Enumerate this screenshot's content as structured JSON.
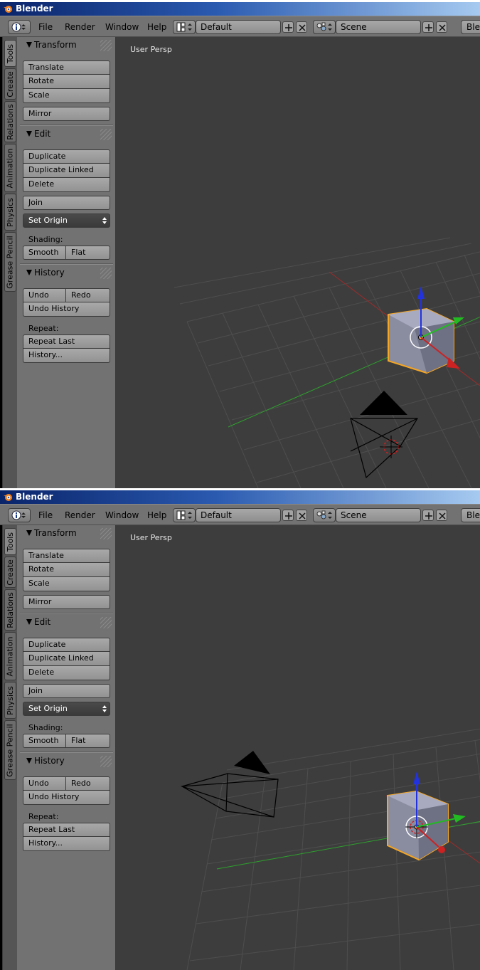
{
  "window_title": "Blender",
  "menu": [
    "File",
    "Render",
    "Window",
    "Help"
  ],
  "screen_layout": "Default",
  "scene_name": "Scene",
  "engine_cut": "Blen",
  "side_tabs": [
    "Tools",
    "Create",
    "Relations",
    "Animation",
    "Physics",
    "Grease Pencil"
  ],
  "transform": {
    "title": "Transform",
    "translate": "Translate",
    "rotate": "Rotate",
    "scale": "Scale",
    "mirror": "Mirror"
  },
  "edit": {
    "title": "Edit",
    "duplicate": "Duplicate",
    "duplicate_linked": "Duplicate Linked",
    "delete": "Delete",
    "join": "Join",
    "set_origin": "Set Origin",
    "shading_label": "Shading:",
    "smooth": "Smooth",
    "flat": "Flat"
  },
  "history": {
    "title": "History",
    "undo": "Undo",
    "redo": "Redo",
    "undo_history": "Undo History",
    "repeat_label": "Repeat:",
    "repeat_last": "Repeat Last",
    "history_more": "History..."
  },
  "viewport_label": "User Persp",
  "colors": {
    "viewport_bg": "#3d3d3d",
    "panel_bg": "#727272",
    "selection_outline": "#f5a623",
    "axis_x": "#cc2222",
    "axis_y": "#22bb22",
    "axis_z": "#2233dd"
  }
}
